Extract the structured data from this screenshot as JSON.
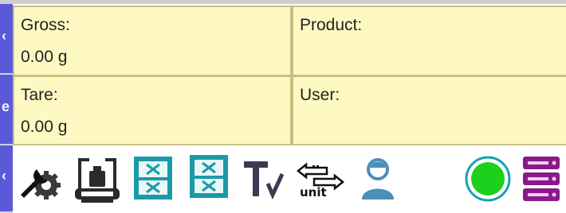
{
  "fields": {
    "gross": {
      "label": "Gross:",
      "value": "0.00 g"
    },
    "tare": {
      "label": "Tare:",
      "value": "0.00 g"
    },
    "product": {
      "label": "Product:"
    },
    "user": {
      "label": "User:"
    }
  },
  "toolbar": {
    "tools": [
      {
        "icon": "wrench-gear-icon",
        "action": "settings"
      },
      {
        "icon": "scale-weight-icon",
        "action": "tare"
      },
      {
        "icon": "database-x-icon",
        "action": "products-database"
      },
      {
        "icon": "database-x-icon",
        "action": "database"
      },
      {
        "icon": "tv-icon",
        "action": "tare-value"
      },
      {
        "icon": "unit-swap-icon",
        "action": "unit",
        "text": "unit"
      },
      {
        "icon": "user-icon",
        "action": "login"
      },
      {
        "icon": "status-green-dot-icon",
        "action": "status"
      },
      {
        "icon": "server-icon",
        "action": "server"
      }
    ]
  },
  "colors": {
    "panel_bg": "#fef9c3",
    "panel_border": "#c7c083",
    "side_strip": "#5a5ad8",
    "teal_icon": "#1a9aa8",
    "status_green": "#1ed01e",
    "status_ring": "#1aa0b0",
    "server_purple": "#8a1a8a"
  }
}
